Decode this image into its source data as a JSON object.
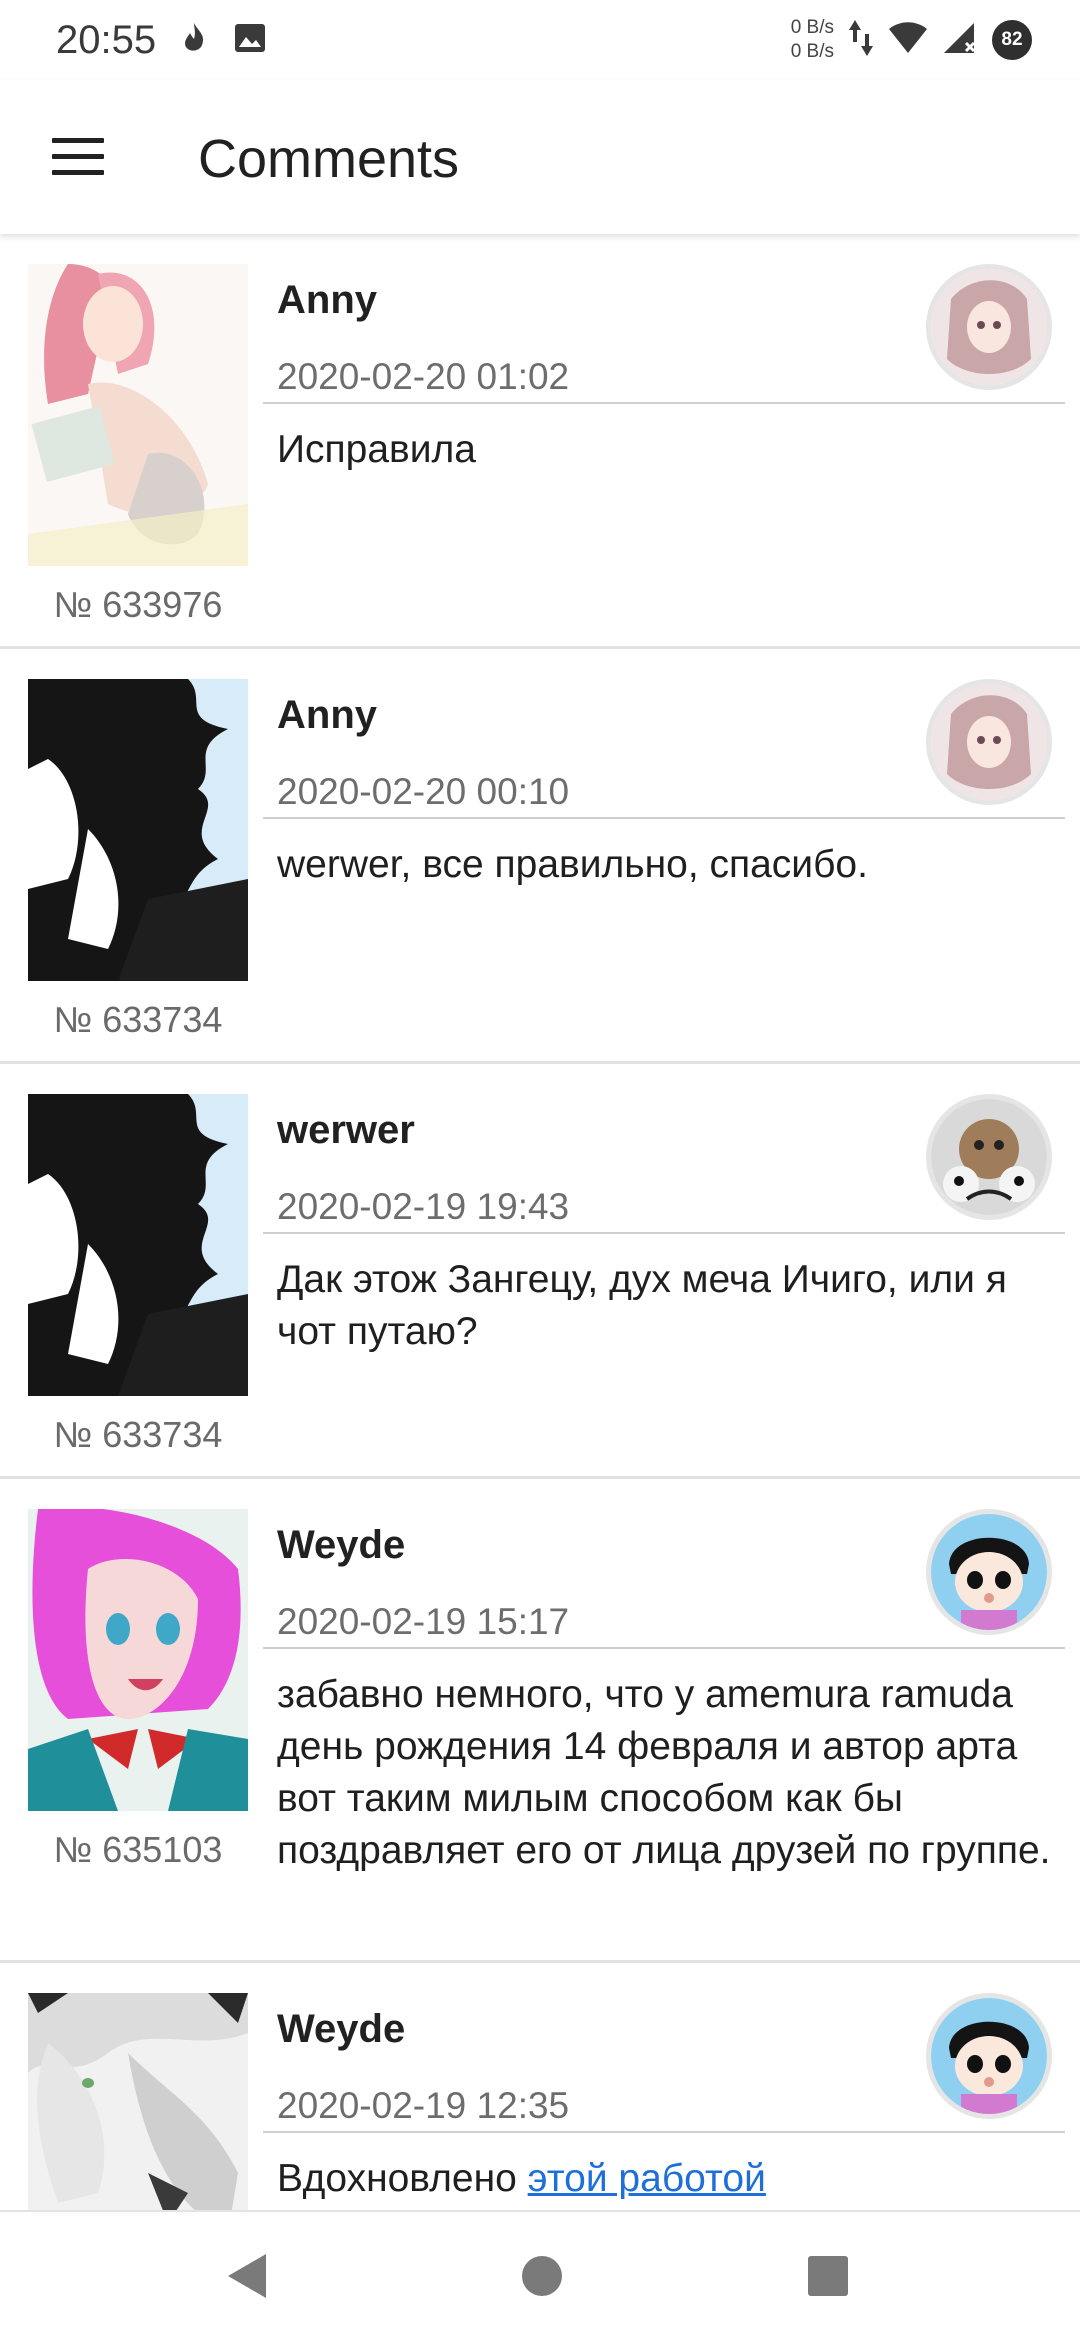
{
  "status_bar": {
    "time": "20:55",
    "net_up": "0 B/s",
    "net_down": "0 B/s",
    "battery": "82",
    "icons": [
      "bonfire-icon",
      "image-icon",
      "data-arrows-icon",
      "wifi-icon",
      "signal-icon"
    ]
  },
  "app_bar": {
    "title": "Comments",
    "menu_icon": "hamburger-menu-icon"
  },
  "comments": [
    {
      "author": "Anny",
      "date": "2020-02-20 01:02",
      "text": "Исправила",
      "post_number": "№ 633976",
      "thumb": "pink-hair-girl-artwork",
      "avatar": "anime-girl-avatar"
    },
    {
      "author": "Anny",
      "date": "2020-02-20 00:10",
      "text": "werwer, все правильно, спасибо.",
      "post_number": "№ 633734",
      "thumb": "black-hair-figure-artwork",
      "avatar": "anime-girl-avatar"
    },
    {
      "author": "werwer",
      "date": "2020-02-19 19:43",
      "text": "Дак этож Зангецу, дух меча Ичиго, или я чот путаю?",
      "post_number": "№ 633734",
      "thumb": "black-hair-figure-artwork",
      "avatar": "spotted-character-avatar"
    },
    {
      "author": "Weyde",
      "date": "2020-02-19 15:17",
      "text": "забавно немного, что у amemura ramuda день рождения 14 февраля и автор арта вот таким милым способом как бы поздравляет его от лица друзей по группе.",
      "post_number": "№ 635103",
      "thumb": "pink-hair-boy-artwork",
      "avatar": "chibi-boy-avatar"
    },
    {
      "author": "Weyde",
      "date": "2020-02-19 12:35",
      "text_prefix": "Вдохновлено ",
      "text_link": "этой работой",
      "thumb": "white-hair-artwork",
      "avatar": "chibi-boy-avatar"
    }
  ],
  "nav_bar": {
    "back": "back-triangle-icon",
    "home": "home-circle-icon",
    "recents": "recents-square-icon"
  },
  "colors": {
    "link": "#1e6fd9",
    "divider": "#e2e2e2",
    "date": "#6d6d6d"
  }
}
